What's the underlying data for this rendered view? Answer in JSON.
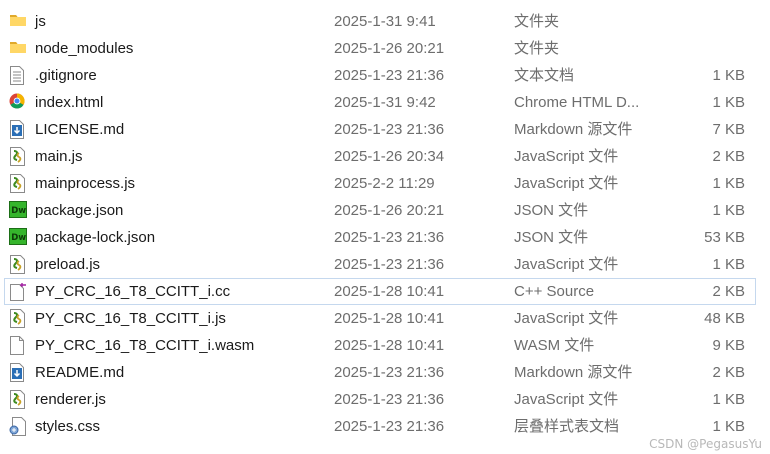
{
  "files": [
    {
      "name": "js",
      "modified": "2025-1-31 9:41",
      "type": "文件夹",
      "size": "",
      "icon": "folder-icon"
    },
    {
      "name": "node_modules",
      "modified": "2025-1-26 20:21",
      "type": "文件夹",
      "size": "",
      "icon": "folder-icon"
    },
    {
      "name": ".gitignore",
      "modified": "2025-1-23 21:36",
      "type": "文本文档",
      "size": "1 KB",
      "icon": "text-file-icon"
    },
    {
      "name": "index.html",
      "modified": "2025-1-31 9:42",
      "type": "Chrome HTML D...",
      "size": "1 KB",
      "icon": "chrome-html-icon"
    },
    {
      "name": "LICENSE.md",
      "modified": "2025-1-23 21:36",
      "type": "Markdown 源文件",
      "size": "7 KB",
      "icon": "markdown-file-icon"
    },
    {
      "name": "main.js",
      "modified": "2025-1-26 20:34",
      "type": "JavaScript 文件",
      "size": "2 KB",
      "icon": "javascript-file-icon"
    },
    {
      "name": "mainprocess.js",
      "modified": "2025-2-2 11:29",
      "type": "JavaScript 文件",
      "size": "1 KB",
      "icon": "javascript-file-icon"
    },
    {
      "name": "package.json",
      "modified": "2025-1-26 20:21",
      "type": "JSON 文件",
      "size": "1 KB",
      "icon": "dreamweaver-json-icon"
    },
    {
      "name": "package-lock.json",
      "modified": "2025-1-23 21:36",
      "type": "JSON 文件",
      "size": "53 KB",
      "icon": "dreamweaver-json-icon"
    },
    {
      "name": "preload.js",
      "modified": "2025-1-23 21:36",
      "type": "JavaScript 文件",
      "size": "1 KB",
      "icon": "javascript-file-icon"
    },
    {
      "name": "PY_CRC_16_T8_CCITT_i.cc",
      "modified": "2025-1-28 10:41",
      "type": "C++ Source",
      "size": "2 KB",
      "icon": "cpp-source-icon",
      "highlighted": true
    },
    {
      "name": "PY_CRC_16_T8_CCITT_i.js",
      "modified": "2025-1-28 10:41",
      "type": "JavaScript 文件",
      "size": "48 KB",
      "icon": "javascript-file-icon"
    },
    {
      "name": "PY_CRC_16_T8_CCITT_i.wasm",
      "modified": "2025-1-28 10:41",
      "type": "WASM 文件",
      "size": "9 KB",
      "icon": "blank-file-icon"
    },
    {
      "name": "README.md",
      "modified": "2025-1-23 21:36",
      "type": "Markdown 源文件",
      "size": "2 KB",
      "icon": "markdown-file-icon"
    },
    {
      "name": "renderer.js",
      "modified": "2025-1-23 21:36",
      "type": "JavaScript 文件",
      "size": "1 KB",
      "icon": "javascript-file-icon"
    },
    {
      "name": "styles.css",
      "modified": "2025-1-23 21:36",
      "type": "层叠样式表文档",
      "size": "1 KB",
      "icon": "css-file-icon"
    }
  ],
  "watermark": "CSDN @PegasusYu"
}
